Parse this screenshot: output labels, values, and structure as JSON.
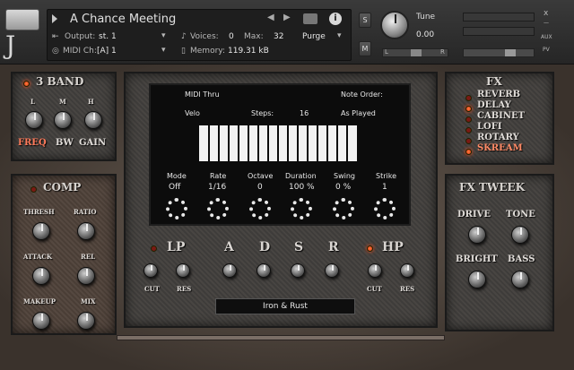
{
  "header": {
    "instrument_name": "A Chance Meeting",
    "output_label": "Output:",
    "output_value": "st. 1",
    "voices_label": "Voices:",
    "voices_value": "0",
    "max_label": "Max:",
    "max_value": "32",
    "purge_label": "Purge",
    "midi_label": "MIDI Ch:",
    "midi_value": "[A]  1",
    "memory_label": "Memory:",
    "memory_value": "119.31 kB",
    "tune_label": "Tune",
    "tune_value": "0.00",
    "s_label": "S",
    "m_label": "M",
    "pan_l": "L",
    "pan_r": "R",
    "aux_label": "AUX",
    "pv_label": "PV",
    "close_label": "x"
  },
  "band": {
    "title": "3 BAND",
    "knob_labels": [
      "L",
      "M",
      "H"
    ],
    "footer": [
      "FREQ",
      "BW",
      "GAIN"
    ]
  },
  "comp": {
    "title": "COMP",
    "labels": [
      "THRESH",
      "RATIO",
      "ATTACK",
      "REL",
      "MAKEUP",
      "MIX"
    ]
  },
  "fx": {
    "title": "FX",
    "items": [
      {
        "label": "REVERB",
        "on": false
      },
      {
        "label": "DELAY",
        "on": true
      },
      {
        "label": "CABINET",
        "on": false
      },
      {
        "label": "LOFI",
        "on": false
      },
      {
        "label": "ROTARY",
        "on": false
      },
      {
        "label": "SKREAM",
        "on": true
      }
    ]
  },
  "fx_tweek": {
    "title": "FX TWEEK",
    "labels": [
      "DRIVE",
      "TONE",
      "BRIGHT",
      "BASS"
    ]
  },
  "arp": {
    "midi_thru": "MIDI Thru",
    "note_order_label": "Note Order:",
    "velo": "Velo",
    "steps_label": "Steps:",
    "steps_value": "16",
    "note_order_value": "As Played",
    "params": [
      {
        "label": "Mode",
        "value": "Off"
      },
      {
        "label": "Rate",
        "value": "1/16"
      },
      {
        "label": "Octave",
        "value": "0"
      },
      {
        "label": "Duration",
        "value": "100 %"
      },
      {
        "label": "Swing",
        "value": "0 %"
      },
      {
        "label": "Strike",
        "value": "1"
      }
    ]
  },
  "filter": {
    "lp": "LP",
    "hp": "HP",
    "adsr": [
      "A",
      "D",
      "S",
      "R"
    ],
    "cut": "CUT",
    "res": "RES"
  },
  "preset": "Iron & Rust"
}
